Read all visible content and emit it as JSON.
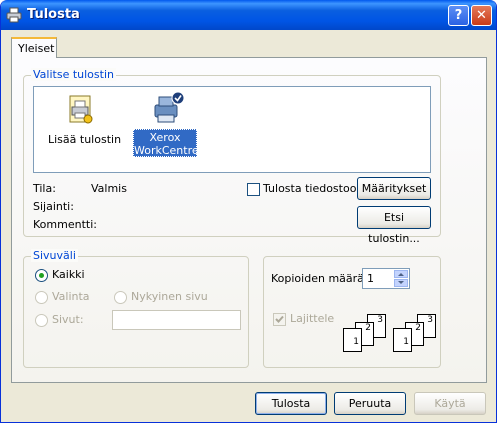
{
  "window": {
    "title": "Tulosta",
    "help_glyph": "?",
    "close_glyph": "✕"
  },
  "tabs": [
    {
      "label": "Yleiset"
    }
  ],
  "printer_group": {
    "label": "Valitse tulostin",
    "printers": [
      {
        "label": "Lisää tulostin",
        "icon": "add-printer-icon"
      },
      {
        "label_line1": "Xerox",
        "label_line2": "WorkCentre",
        "icon": "printer-icon",
        "selected": true
      }
    ],
    "status_label": "Tila:",
    "status_value": "Valmis",
    "location_label": "Sijainti:",
    "comment_label": "Kommentti:",
    "print_to_file_label": "Tulosta tiedostoon",
    "preferences_button": "Määritykset",
    "find_printer_button": "Etsi tulostin..."
  },
  "range_group": {
    "label": "Sivuväli",
    "all_label": "Kaikki",
    "selection_label": "Valinta",
    "current_page_label": "Nykyinen sivu",
    "pages_label": "Sivut:",
    "pages_value": ""
  },
  "copies_group": {
    "copies_label": "Kopioiden määrä:",
    "copies_value": "1",
    "collate_label": "Lajittele",
    "collate_checked": true,
    "collate_pages": [
      "1",
      "2",
      "3"
    ]
  },
  "footer": {
    "print_button": "Tulosta",
    "cancel_button": "Peruuta",
    "apply_button": "Käytä"
  },
  "colors": {
    "title_bar": "#0055e5",
    "group_label": "#0046d5",
    "selection": "#316ac5"
  }
}
